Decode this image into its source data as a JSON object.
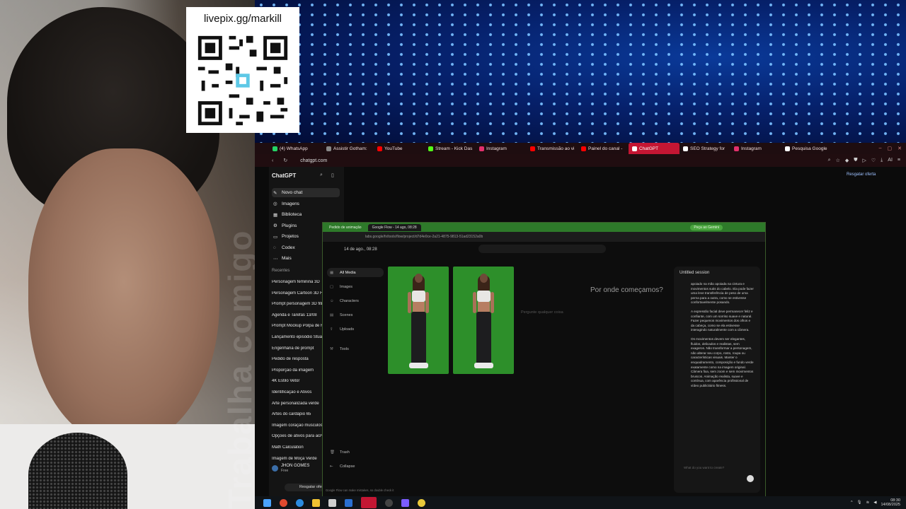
{
  "overlay": {
    "qr_title": "livepix.gg/markill",
    "watermark": "Trabalha comigo"
  },
  "browser": {
    "tabs": [
      {
        "label": "(4) WhatsApp",
        "color": "#25d366"
      },
      {
        "label": "Assistir Gotham:",
        "color": "#888888"
      },
      {
        "label": "YouTube",
        "color": "#ff0000"
      },
      {
        "label": "Stream - Kick Das",
        "color": "#53fc18"
      },
      {
        "label": "Instagram",
        "color": "#e1306c"
      },
      {
        "label": "Transmissão ao vi",
        "color": "#ff0000"
      },
      {
        "label": "Painel do canal -",
        "color": "#ff0000"
      },
      {
        "label": "ChatGPT",
        "color": "#ffffff",
        "active": true
      },
      {
        "label": "SEO Strategy for",
        "color": "#ffffff"
      },
      {
        "label": "Instagram",
        "color": "#e1306c"
      },
      {
        "label": "Pesquisa Google",
        "color": "#ffffff"
      }
    ],
    "url": "chatgpt.com",
    "resgatar": "Resgatar oferta"
  },
  "chatgpt": {
    "title": "ChatGPT",
    "nav": [
      {
        "label": "Novo chat",
        "icon": "✎"
      },
      {
        "label": "Imagens",
        "icon": "◎"
      },
      {
        "label": "Biblioteca",
        "icon": "▦"
      },
      {
        "label": "Plugins",
        "icon": "⚙"
      },
      {
        "label": "Projetos",
        "icon": "▭"
      },
      {
        "label": "Codex",
        "icon": "◌"
      },
      {
        "label": "Mais",
        "icon": "⋯"
      }
    ],
    "recent_heading": "Recentes",
    "recents": [
      "Personagem feminina 3D",
      "Personagem Cartoon 3D Fitness",
      "Prompt personagem 3D fitness",
      "Agenda e Tarefas 13/08",
      "Prompt Mockup Polpa de Fruta",
      "Lançamento episódio Stuart",
      "Engenharia de prompt",
      "Pedido de resposta",
      "Proporção da imagem",
      "4K Estilo Vetor",
      "Identificação e Ativos",
      "Arte personalizada verde",
      "Artes do cardápio 65",
      "Imagem coração musculoso",
      "Opções de ativos para acrv",
      "Math Calculation",
      "Imagem de Moça Verde"
    ],
    "user_name": "JHON GOMES",
    "user_plan": "Free",
    "promo": "Resgatar oferta"
  },
  "inner": {
    "tabs": [
      "Pedido de animação",
      "Google Flow - 14 ago, 08:28"
    ],
    "gemini": "Peça ao Gemini",
    "url": "labs.google/fx/tools/flow/project/d7d4e0ce-2a21-4875-9813-51ad23152a0b",
    "date": "14 de ago., 08:28",
    "nav": [
      "All Media",
      "Images",
      "Characters",
      "Scenes",
      "Uploads",
      "Tools"
    ],
    "trash": "Trash",
    "collapse": "Collapse",
    "prompt_title": "Por onde começamos?",
    "prompt_placeholder": "Pergunte qualquer coisa",
    "session_title": "Untitled session",
    "session_paragraphs": [
      "apoiado na mão apoiada na cintura e movimentos sutis do cabelo. Ela pode fazer uma leve transferência de peso de uma perna para a outra, como se estivesse confortavelmente posando.",
      "A expressão facial deve permanecer feliz e confiante, com um sorriso suave e natural. Fazer pequenos movimentos dos olhos e da cabeça, como se ela estivesse interagindo naturalmente com a câmera.",
      "Os movimentos devem ser elegantes, fluidos, delicados e realistas, sem exageros. Não transformar a personagem, não alterar seu corpo, rosto, roupa ou características visuais. Manter o enquadramento, composição e fundo verde exatamente como na imagem original. Câmera fixa, sem zoom e sem movimentos bruscos. Animação realista, suave e contínua, com aparência profissional de vídeo publicitário fitness."
    ],
    "session_input": "What do you want to create?",
    "footer": "Google Flow can make mistakes, so double check it"
  },
  "taskbar": {
    "time": "08:30",
    "date": "14/08/2025"
  }
}
